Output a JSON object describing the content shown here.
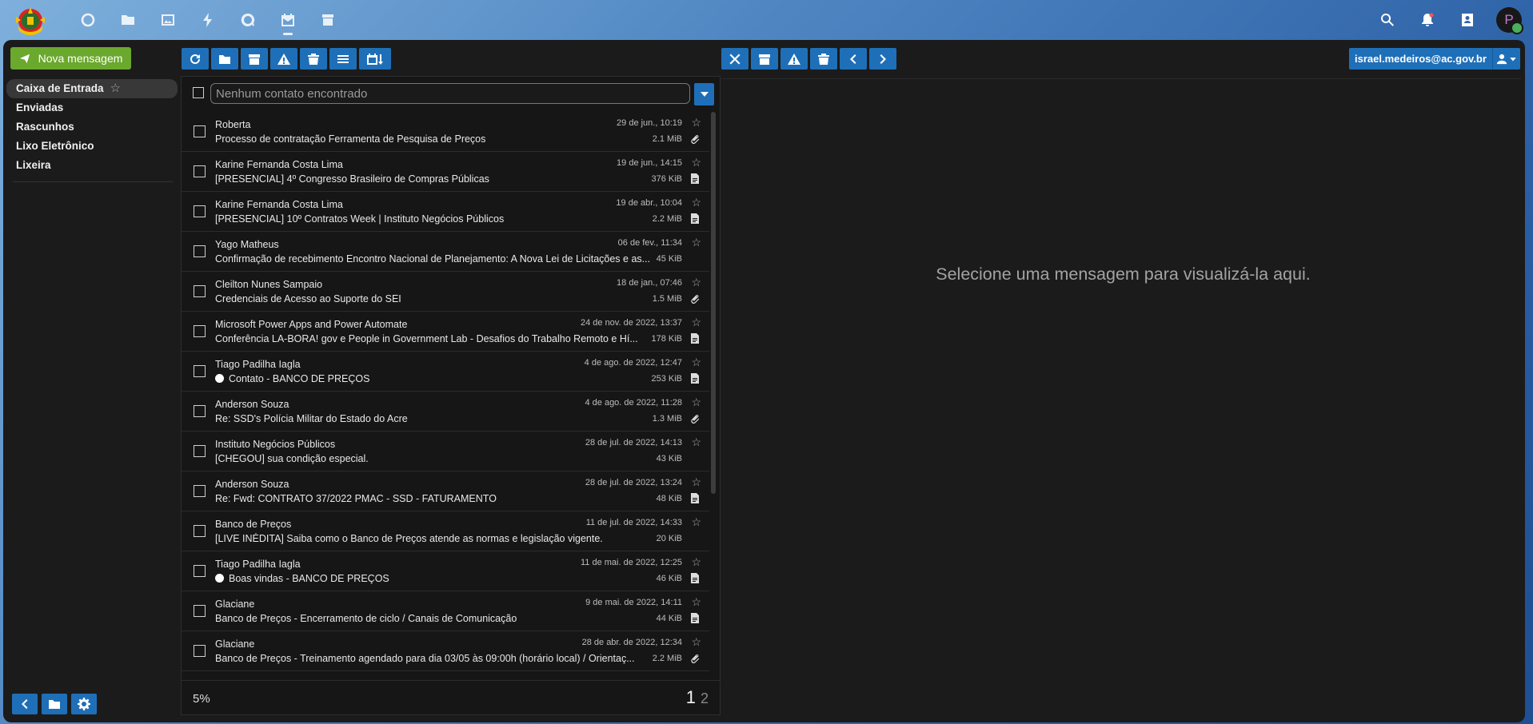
{
  "topbar": {
    "apps": [
      "home-icon",
      "folder-icon",
      "image-icon",
      "bolt-icon",
      "chat-icon",
      "calendar-mail-icon",
      "package-icon"
    ],
    "active_app": "calendar-mail-icon",
    "right_icons": [
      "search-icon",
      "bell-icon",
      "contacts-icon"
    ],
    "avatar_letter": "P"
  },
  "sidebar": {
    "new_message_label": "Nova mensagem",
    "folders": [
      {
        "label": "Caixa de Entrada",
        "active": true
      },
      {
        "label": "Enviadas"
      },
      {
        "label": "Rascunhos"
      },
      {
        "label": "Lixo Eletrônico"
      },
      {
        "label": "Lixeira"
      }
    ]
  },
  "list": {
    "search_placeholder": "Nenhum contato encontrado",
    "messages": [
      {
        "sender": "Roberta",
        "subject": "Processo de contratação Ferramenta de Pesquisa de Preços",
        "date": "29 de jun., 10:19",
        "size": "2.1 MiB",
        "attachment": "paperclip",
        "dot": false
      },
      {
        "sender": "Karine Fernanda Costa Lima",
        "subject": "[PRESENCIAL] 4º Congresso Brasileiro de Compras Públicas",
        "date": "19 de jun., 14:15",
        "size": "376 KiB",
        "attachment": "document",
        "dot": false
      },
      {
        "sender": "Karine Fernanda Costa Lima",
        "subject": "[PRESENCIAL] 10º Contratos Week | Instituto Negócios Públicos",
        "date": "19 de abr., 10:04",
        "size": "2.2 MiB",
        "attachment": "document",
        "dot": false
      },
      {
        "sender": "Yago Matheus",
        "subject": "Confirmação de recebimento Encontro Nacional de Planejamento: A Nova Lei de Licitações e as...",
        "date": "06 de fev., 11:34",
        "size": "45 KiB",
        "attachment": "",
        "dot": false
      },
      {
        "sender": "Cleilton Nunes Sampaio",
        "subject": "Credenciais de Acesso ao Suporte do SEI",
        "date": "18 de jan., 07:46",
        "size": "1.5 MiB",
        "attachment": "paperclip",
        "dot": false
      },
      {
        "sender": "Microsoft Power Apps and Power Automate",
        "subject": "Conferência LA-BORA! gov e People in Government Lab - Desafios do Trabalho Remoto e Hí...",
        "date": "24 de nov. de 2022, 13:37",
        "size": "178 KiB",
        "attachment": "document",
        "dot": false
      },
      {
        "sender": "Tiago Padilha Iagla",
        "subject": "Contato - BANCO DE PREÇOS",
        "date": "4 de ago. de 2022, 12:47",
        "size": "253 KiB",
        "attachment": "document",
        "dot": true
      },
      {
        "sender": "Anderson Souza",
        "subject": "Re: SSD's Polícia Militar do Estado do Acre",
        "date": "4 de ago. de 2022, 11:28",
        "size": "1.3 MiB",
        "attachment": "paperclip",
        "dot": false
      },
      {
        "sender": "Instituto Negócios Públicos",
        "subject": "[CHEGOU] sua condição especial.",
        "date": "28 de jul. de 2022, 14:13",
        "size": "43 KiB",
        "attachment": "",
        "dot": false
      },
      {
        "sender": "Anderson Souza",
        "subject": "Re: Fwd: CONTRATO 37/2022 PMAC - SSD - FATURAMENTO",
        "date": "28 de jul. de 2022, 13:24",
        "size": "48 KiB",
        "attachment": "document",
        "dot": false
      },
      {
        "sender": "Banco de Preços",
        "subject": "[LIVE INÉDITA] Saiba como o Banco de Preços atende as normas e legislação vigente.",
        "date": "11 de jul. de 2022, 14:33",
        "size": "20 KiB",
        "attachment": "",
        "dot": false
      },
      {
        "sender": "Tiago Padilha Iagla",
        "subject": "Boas vindas - BANCO DE PREÇOS",
        "date": "11 de mai. de 2022, 12:25",
        "size": "46 KiB",
        "attachment": "document",
        "dot": true
      },
      {
        "sender": "Glaciane",
        "subject": "Banco de Preços - Encerramento de ciclo / Canais de Comunicação",
        "date": "9 de mai. de 2022, 14:11",
        "size": "44 KiB",
        "attachment": "document",
        "dot": false
      },
      {
        "sender": "Glaciane",
        "subject": "Banco de Preços - Treinamento agendado para dia 03/05 às 09:00h (horário local) / Orientaç...",
        "date": "28 de abr. de 2022, 12:34",
        "size": "2.2 MiB",
        "attachment": "paperclip",
        "dot": false
      }
    ],
    "progress": "5%",
    "page_current": "1",
    "page_next": "2"
  },
  "reader": {
    "empty_text": "Selecione uma mensagem para visualizá-la aqui.",
    "account_email": "israel.medeiros@ac.gov.br"
  },
  "colors": {
    "accent_blue": "#1f6fb8",
    "new_message_green": "#6ba82e",
    "panel_bg": "#1b1b1b"
  }
}
